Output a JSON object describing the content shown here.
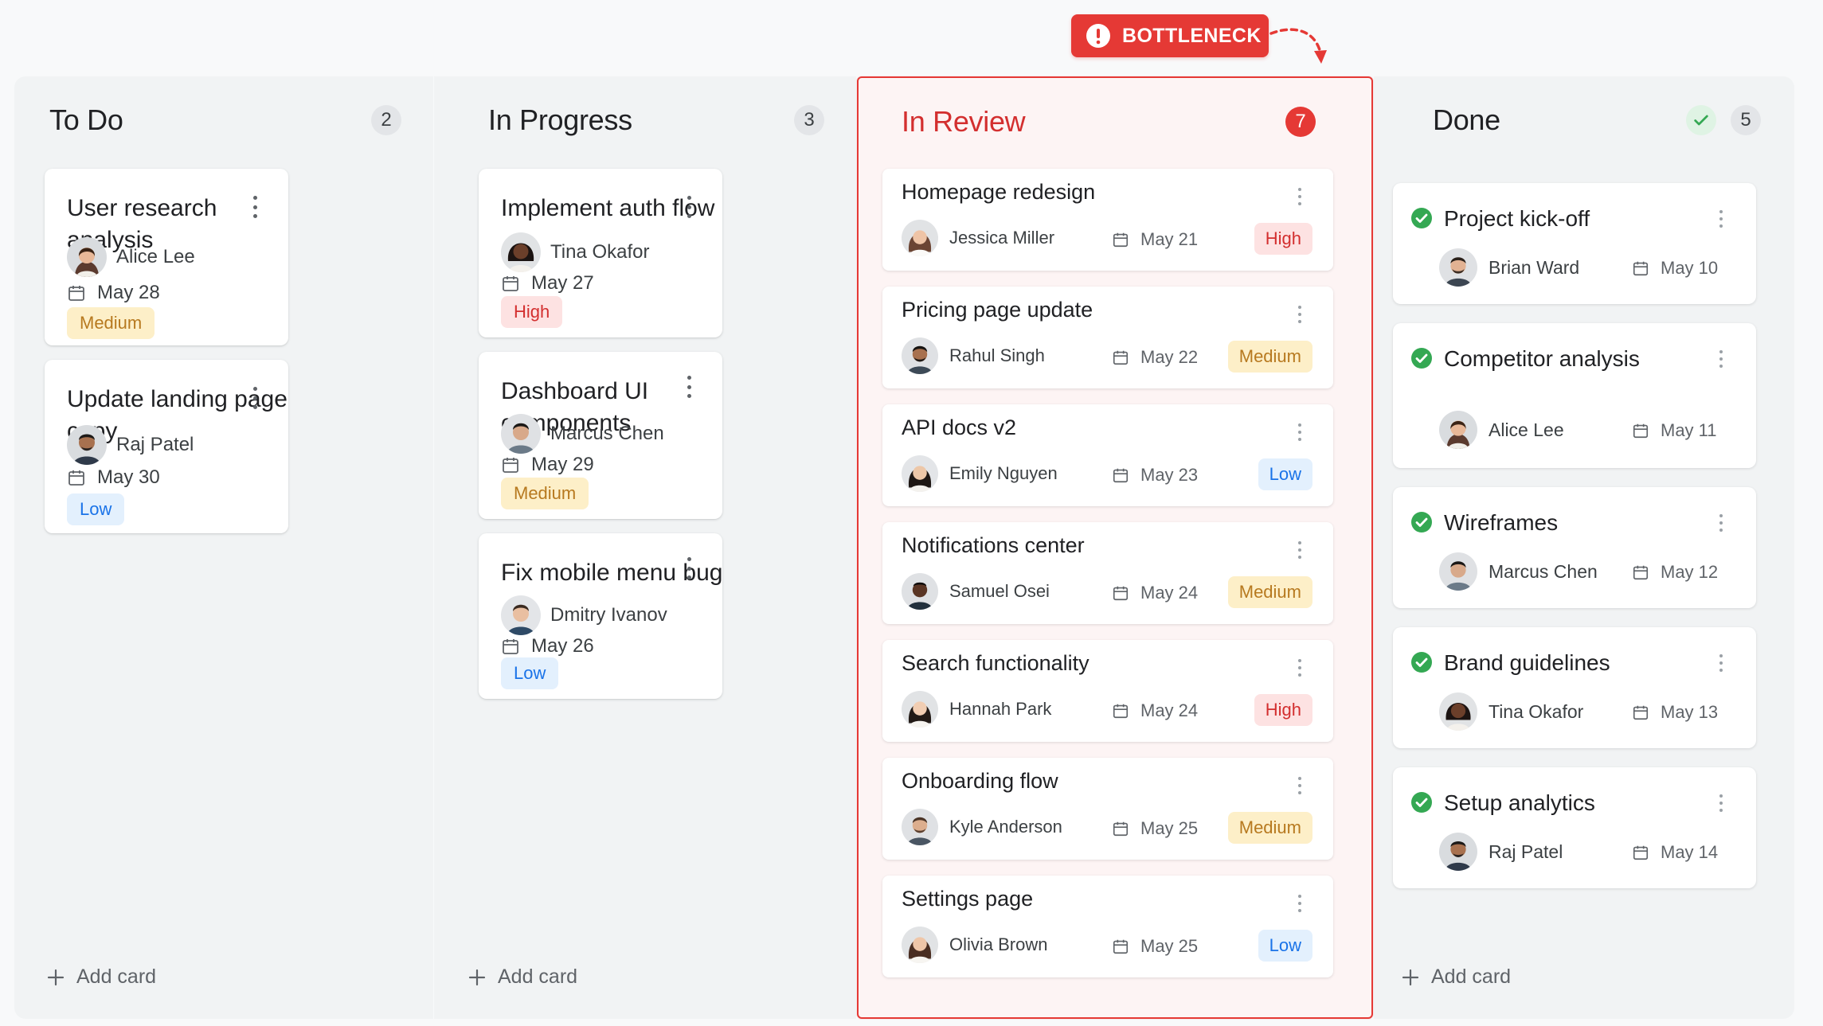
{
  "callout": {
    "label": "BOTTLENECK",
    "color": "#e53935"
  },
  "columns": [
    {
      "title": "To Do",
      "count": "2"
    },
    {
      "title": "In Progress",
      "count": "3"
    },
    {
      "title": "In Review",
      "count": "7"
    },
    {
      "title": "Done",
      "count": "5"
    }
  ],
  "add_card_label": "Add card",
  "todo": [
    {
      "title": "User research analysis",
      "assignee": "Alice Lee",
      "date": "May 28",
      "priority": "Medium"
    },
    {
      "title": "Update landing page copy",
      "assignee": "Raj Patel",
      "date": "May 30",
      "priority": "Low"
    }
  ],
  "in_progress": [
    {
      "title": "Implement auth flow",
      "assignee": "Tina Okafor",
      "date": "May 27",
      "priority": "High"
    },
    {
      "title": "Dashboard UI components",
      "assignee": "Marcus Chen",
      "date": "May 29",
      "priority": "Medium"
    },
    {
      "title": "Fix mobile menu bug",
      "assignee": "Dmitry Ivanov",
      "date": "May 26",
      "priority": "Low"
    }
  ],
  "in_review": [
    {
      "title": "Homepage redesign",
      "assignee": "Jessica Miller",
      "date": "May 21",
      "priority": "High"
    },
    {
      "title": "Pricing page update",
      "assignee": "Rahul Singh",
      "date": "May 22",
      "priority": "Medium"
    },
    {
      "title": "API docs v2",
      "assignee": "Emily Nguyen",
      "date": "May 23",
      "priority": "Low"
    },
    {
      "title": "Notifications center",
      "assignee": "Samuel Osei",
      "date": "May 24",
      "priority": "Medium"
    },
    {
      "title": "Search functionality",
      "assignee": "Hannah Park",
      "date": "May 24",
      "priority": "High"
    },
    {
      "title": "Onboarding flow",
      "assignee": "Kyle Anderson",
      "date": "May 25",
      "priority": "Medium"
    },
    {
      "title": "Settings page",
      "assignee": "Olivia Brown",
      "date": "May 25",
      "priority": "Low"
    }
  ],
  "done": [
    {
      "title": "Project kick-off",
      "assignee": "Brian Ward",
      "date": "May 10"
    },
    {
      "title": "Competitor analysis",
      "assignee": "Alice Lee",
      "date": "May 11"
    },
    {
      "title": "Wireframes",
      "assignee": "Marcus Chen",
      "date": "May 12"
    },
    {
      "title": "Brand guidelines",
      "assignee": "Tina Okafor",
      "date": "May 13"
    },
    {
      "title": "Setup analytics",
      "assignee": "Raj Patel",
      "date": "May 14"
    }
  ],
  "icons": {
    "calendar": "calendar-icon",
    "more": "more-vert-icon",
    "add": "plus-icon",
    "done": "check-circle-icon",
    "alert": "alert-circle-icon"
  },
  "colors": {
    "high": "#d32f2f",
    "medium": "#b7791f",
    "low": "#1a73e8",
    "done_green": "#34a853"
  }
}
